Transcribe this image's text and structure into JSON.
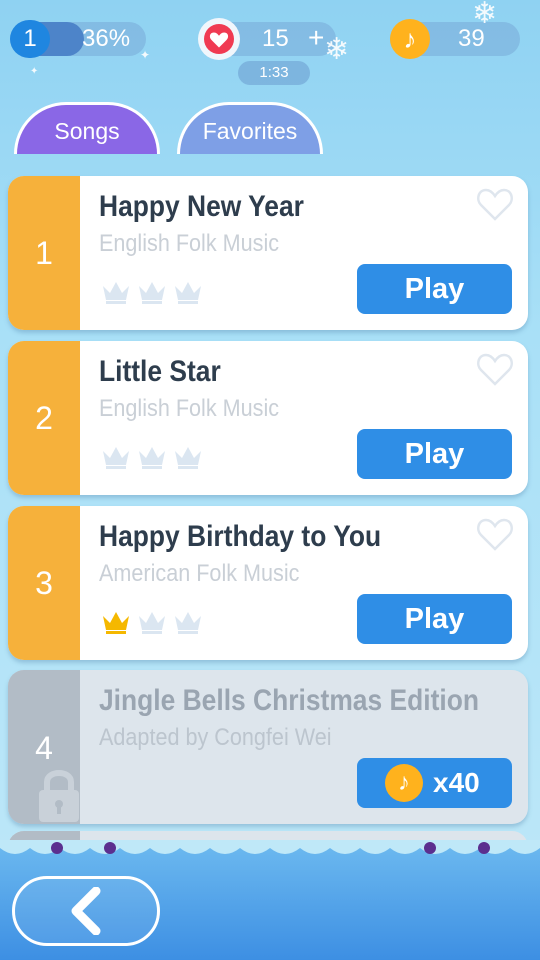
{
  "status": {
    "level": "1",
    "progress": "36%",
    "lives": "15",
    "add_lives": "+",
    "timer": "1:33",
    "coins": "39"
  },
  "tabs": [
    {
      "label": "Songs",
      "active": true
    },
    {
      "label": "Favorites",
      "active": false
    }
  ],
  "songs": [
    {
      "rank": "1",
      "title": "Happy New Year",
      "artist": "English Folk Music",
      "crowns_earned": 0,
      "action": "Play"
    },
    {
      "rank": "2",
      "title": "Little Star",
      "artist": "English Folk Music",
      "crowns_earned": 0,
      "action": "Play"
    },
    {
      "rank": "3",
      "title": "Happy Birthday to You",
      "artist": "American Folk Music",
      "crowns_earned": 1,
      "action": "Play"
    },
    {
      "rank": "4",
      "title": "Jingle Bells Christmas Edition",
      "artist": "Adapted by Congfei Wei",
      "locked": true,
      "price": "x40"
    }
  ],
  "colors": {
    "rank_strip": "#f6b13b",
    "rank_strip_locked": "#b2bcc6",
    "play_button": "#2f8ee6",
    "tab_songs": "#8a67e6",
    "tab_favorites": "#7e9fe6",
    "crown_earned": "#f5b800",
    "crown_empty": "#dbe6f1"
  },
  "icons": {
    "heart": "heart-icon",
    "coin": "music-note-coin-icon",
    "crown": "crown-icon",
    "lock": "lock-icon",
    "back": "chevron-left-icon"
  }
}
